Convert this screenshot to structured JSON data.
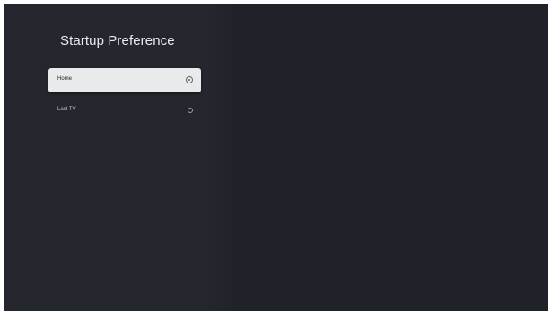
{
  "page": {
    "title": "Startup Preference"
  },
  "options": [
    {
      "label": "Home",
      "selected": true
    },
    {
      "label": "Last TV",
      "selected": false
    }
  ],
  "colors": {
    "background": "#1f2228",
    "panel": "#24272d",
    "selected_item": "#e9eaec",
    "title_text": "#e8eaed"
  },
  "icons": {
    "radio_selected": "radio-selected-icon",
    "radio_unselected": "radio-unselected-icon"
  }
}
